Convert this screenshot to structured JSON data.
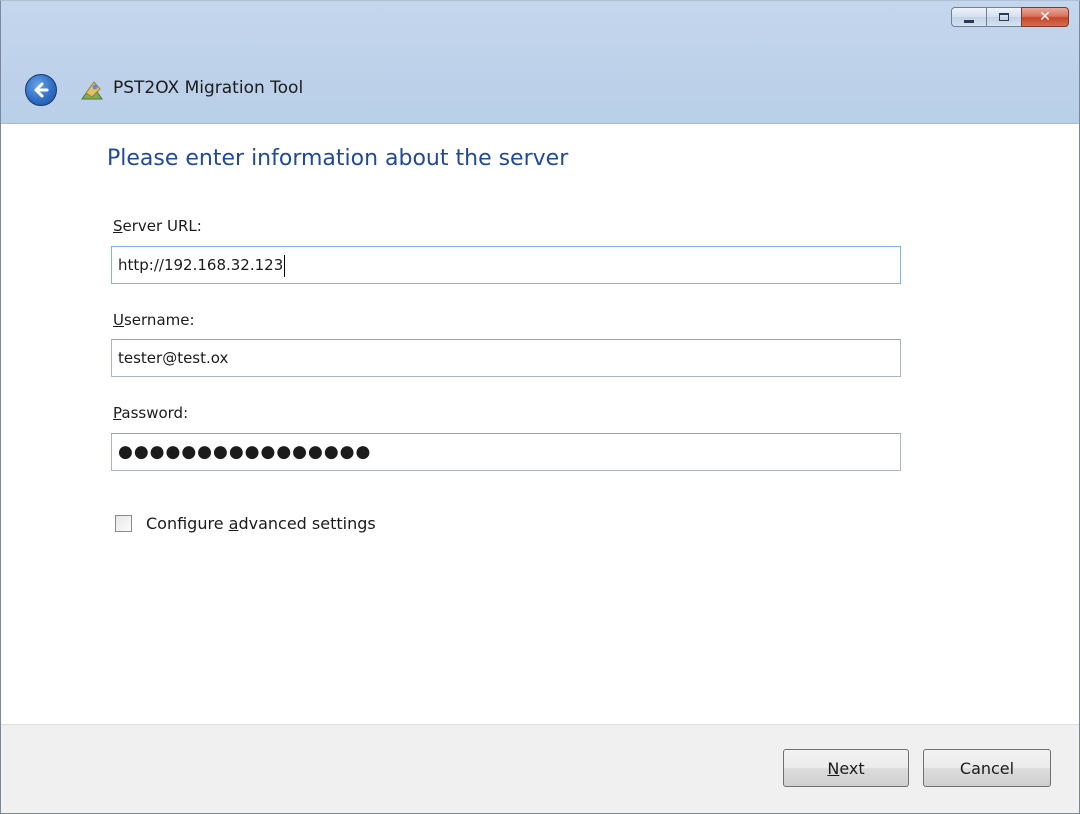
{
  "window": {
    "title": "PST2OX Migration Tool"
  },
  "icons": {
    "back": "back-arrow-icon",
    "app": "app-icon",
    "minimize": "minimize-icon",
    "maximize": "maximize-icon",
    "close": "close-icon"
  },
  "caption": {
    "close_glyph": "✕"
  },
  "main": {
    "heading": "Please enter information about the server",
    "server_url": {
      "label_accel": "S",
      "label_rest": "erver URL:",
      "value": "http://192.168.32.123"
    },
    "username": {
      "label_accel": "U",
      "label_rest": "sername:",
      "value": "tester@test.ox"
    },
    "password": {
      "label_accel": "P",
      "label_rest": "assword:",
      "value": "●●●●●●●●●●●●●●●●"
    },
    "advanced": {
      "label_pre": "Configure ",
      "label_accel": "a",
      "label_rest": "dvanced settings",
      "checked": false
    }
  },
  "footer": {
    "next_accel": "N",
    "next_rest": "ext",
    "cancel_label": "Cancel"
  },
  "colors": {
    "heading": "#1f4a9c",
    "titlebar": "#bfd3ea",
    "footer": "#f0f0f0"
  }
}
